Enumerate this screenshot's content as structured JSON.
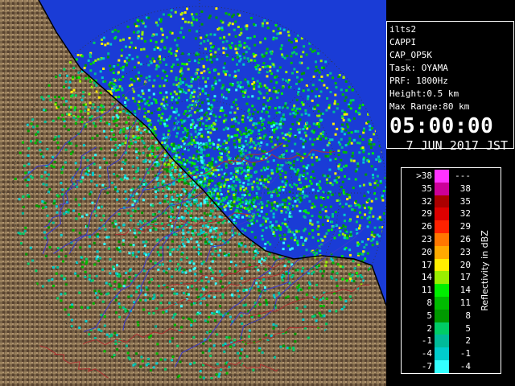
{
  "radar": {
    "station": "ilts2",
    "product": "CAPPI",
    "config": "CAP_OP5K",
    "task": "Task: OYAMA",
    "prf": "PRF: 1800Hz",
    "height": "Height:0.5 km",
    "max_range": "Max Range:80 km",
    "time": "05:00:00",
    "date": "7 JUN 2017 JST"
  },
  "legend": {
    "unit_label": "Reflectivity in dBZ",
    "rows": [
      {
        "lo": ">38",
        "hi": "---",
        "color": "#ff33ff"
      },
      {
        "lo": "35",
        "hi": "38",
        "color": "#cc0099"
      },
      {
        "lo": "32",
        "hi": "35",
        "color": "#aa0000"
      },
      {
        "lo": "29",
        "hi": "32",
        "color": "#dd0000"
      },
      {
        "lo": "26",
        "hi": "29",
        "color": "#ff2200"
      },
      {
        "lo": "23",
        "hi": "26",
        "color": "#ff7700"
      },
      {
        "lo": "20",
        "hi": "23",
        "color": "#ffaa00"
      },
      {
        "lo": "17",
        "hi": "20",
        "color": "#ffee00"
      },
      {
        "lo": "14",
        "hi": "17",
        "color": "#99ee00"
      },
      {
        "lo": "11",
        "hi": "14",
        "color": "#00ee00"
      },
      {
        "lo": "8",
        "hi": "11",
        "color": "#00bb00"
      },
      {
        "lo": "5",
        "hi": "8",
        "color": "#009900"
      },
      {
        "lo": "2",
        "hi": "5",
        "color": "#00cc66"
      },
      {
        "lo": "-1",
        "hi": "2",
        "color": "#00bb99"
      },
      {
        "lo": "-4",
        "hi": "-1",
        "color": "#00cccc"
      },
      {
        "lo": "-7",
        "hi": "-4",
        "color": "#33ffff"
      }
    ]
  },
  "colors": {
    "sea": "#1a3cd6",
    "land": "#7a6448",
    "rivers": "#3a3ad0",
    "boundaries": "#b03030"
  }
}
